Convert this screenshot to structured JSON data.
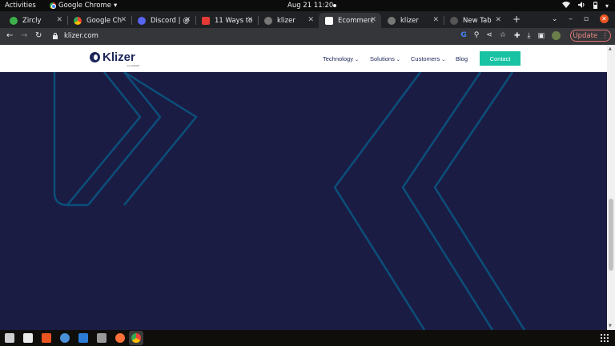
{
  "topbar": {
    "activities": "Activities",
    "app_menu": "Google Chrome",
    "clock": "Aug 21  11:20"
  },
  "tabs": [
    {
      "title": "Zircly",
      "icon": "zircly-icon",
      "color": "#3cb04a"
    },
    {
      "title": "Google Ch",
      "icon": "chrome-icon",
      "color": "#4285f4"
    },
    {
      "title": "Discord | @",
      "icon": "discord-icon",
      "color": "#5865f2"
    },
    {
      "title": "11 Ways to",
      "icon": "article-icon",
      "color": "#e53935"
    },
    {
      "title": "klizer",
      "icon": "globe-icon",
      "color": "#777777"
    },
    {
      "title": "Ecommerc",
      "icon": "klizer-icon",
      "color": "#ffffff",
      "active": true
    },
    {
      "title": "klizer",
      "icon": "globe-icon",
      "color": "#777777"
    },
    {
      "title": "New Tab",
      "icon": "newtab-icon",
      "color": "#555555"
    }
  ],
  "address_bar": {
    "url": "klizer.com"
  },
  "browser": {
    "update_label": "Update"
  },
  "site": {
    "logo_text": "Klizer",
    "logo_sub": "by DCKAP",
    "nav": [
      {
        "label": "Technology",
        "has_dropdown": true
      },
      {
        "label": "Solutions",
        "has_dropdown": true
      },
      {
        "label": "Customers",
        "has_dropdown": true
      },
      {
        "label": "Blog",
        "has_dropdown": false
      }
    ],
    "contact_label": "Contact",
    "colors": {
      "hero_bg": "#1b1c44",
      "accent": "#17c3a3",
      "chevron_stroke": "#0b4f7a",
      "brand": "#1b2559"
    }
  },
  "dock": {
    "apps": [
      "files-icon",
      "text-editor-icon",
      "software-center-icon",
      "settings-icon",
      "vscode-icon",
      "image-viewer-icon",
      "firefox-icon",
      "chrome-icon"
    ]
  }
}
